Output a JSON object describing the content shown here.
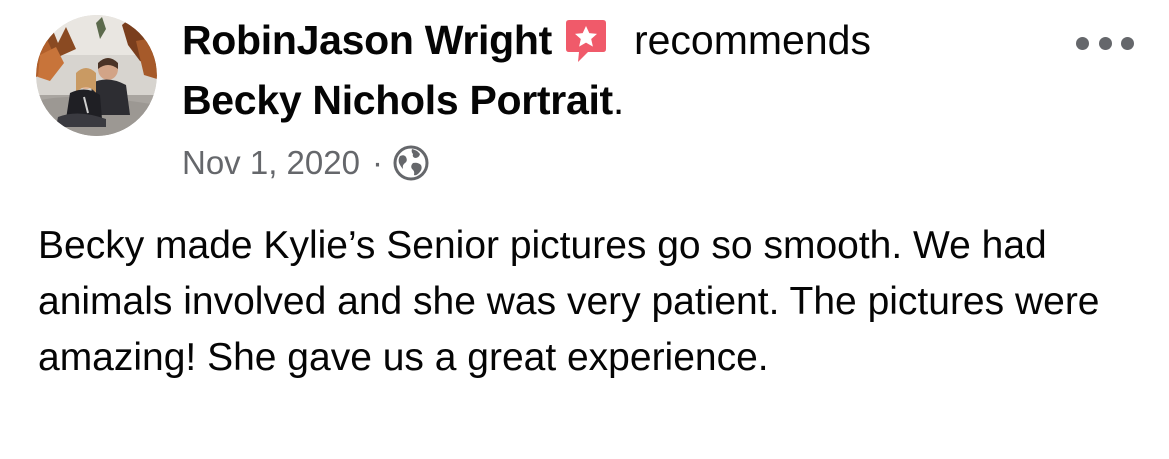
{
  "post": {
    "author": "RobinJason Wright",
    "action": "recommends",
    "page_name": "Becky Nichols Portrait",
    "period": ".",
    "date": "Nov 1, 2020",
    "separator": "·",
    "privacy_icon": "globe-icon",
    "recommend_icon": "recommend-star-icon",
    "more_icon": "more-options-icon",
    "body": "Becky made Kylie’s Senior pictures go so smooth. We had animals involved and she was very patient. The pictures were amazing! She gave us a great experience."
  },
  "colors": {
    "text_primary": "#050505",
    "text_secondary": "#65676b",
    "recommend_red": "#f05a6a"
  }
}
